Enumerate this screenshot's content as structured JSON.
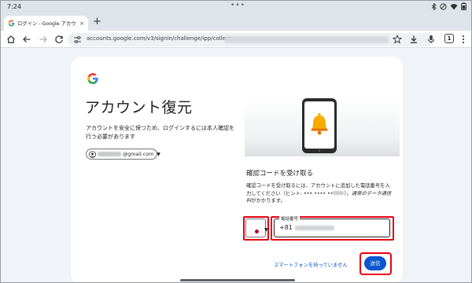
{
  "status_bar": {
    "time": "7:24",
    "dots": "•••"
  },
  "tab": {
    "title": "ログイン - Google アカウ",
    "close": "×",
    "new_tab": "+"
  },
  "toolbar": {
    "url": "accounts.google.com/v3/signin/challenge/ipp/collect",
    "tab_count": "1"
  },
  "card": {
    "title": "アカウント復元",
    "description": "アカウントを安全に保つため、ログインするには本人確認を行う必要があります",
    "account_email": "@gmail.com",
    "section_title": "確認コードを受け取る",
    "section_desc_prefix": "確認コードを受け取るには、アカウントに追加した電話番号を入力してください（ヒント: ••• •••• ••",
    "section_desc_suffix": "）。",
    "section_desc_italic": "通常のデータ通信料",
    "section_desc_end": "がかかります。",
    "phone_label": "電話番号",
    "phone_prefix": "+81",
    "no_phone_link": "スマートフォンを持っていません",
    "send_button": "送信"
  },
  "colors": {
    "accent_blue": "#0b57d0",
    "highlight_red": "#e60012",
    "bell_yellow": "#f9ab00",
    "page_bg": "#f0f4f9"
  },
  "icons": [
    "back-icon",
    "forward-icon",
    "reload-icon",
    "home-icon",
    "star-icon",
    "download-icon",
    "mic-icon",
    "menu-icon",
    "google-logo",
    "bell-icon",
    "avatar-icon"
  ]
}
